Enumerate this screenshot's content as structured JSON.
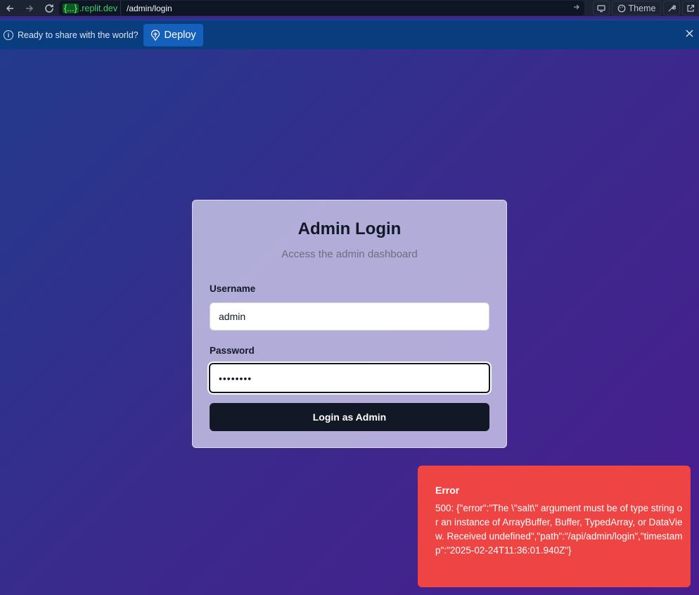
{
  "browser": {
    "domain_braces": "{...}",
    "domain": ".replit.dev",
    "path": "/admin/login",
    "theme_label": "Theme"
  },
  "banner": {
    "message": "Ready to share with the world?",
    "deploy_label": "Deploy"
  },
  "login": {
    "title": "Admin Login",
    "subtitle": "Access the admin dashboard",
    "username_label": "Username",
    "username_value": "admin",
    "password_label": "Password",
    "password_value": "••••••••",
    "submit_label": "Login as Admin"
  },
  "toast": {
    "title": "Error",
    "message": "500: {\"error\":\"The \\\"salt\\\" argument must be of type string or an instance of ArrayBuffer, Buffer, TypedArray, or DataView. Received undefined\",\"path\":\"/api/admin/login\",\"timestamp\":\"2025-02-24T11:36:01.940Z\"}"
  },
  "colors": {
    "error": "#ef4444",
    "button": "#121826",
    "banner": "#0a3d7d",
    "deploy": "#1560bd"
  }
}
